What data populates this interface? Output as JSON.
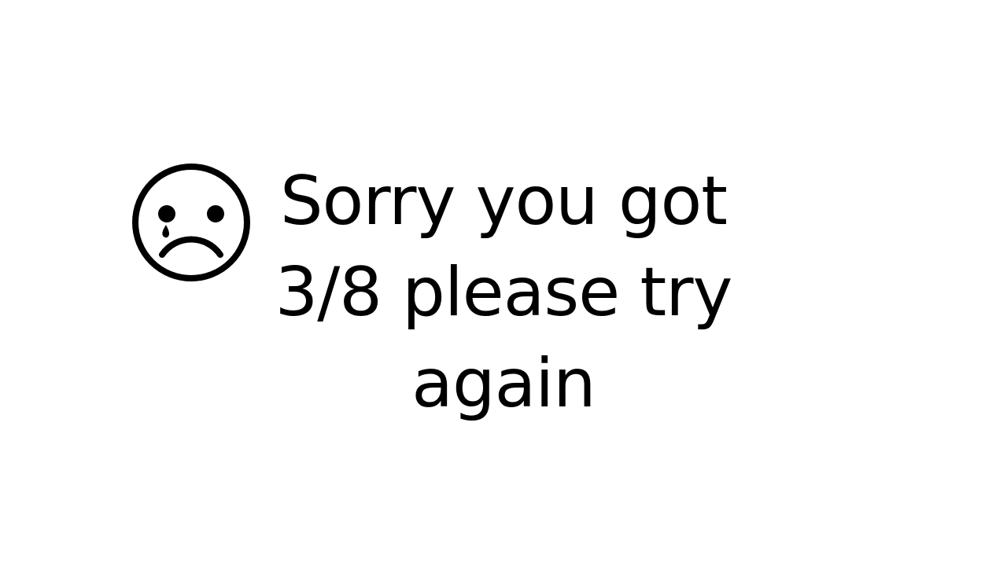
{
  "message": {
    "lines": [
      "Sorry you got",
      "3/8 please try",
      "again"
    ]
  },
  "icon": "crying-sad-face-icon",
  "colors": {
    "background": "#ffffff",
    "text": "#000000"
  }
}
